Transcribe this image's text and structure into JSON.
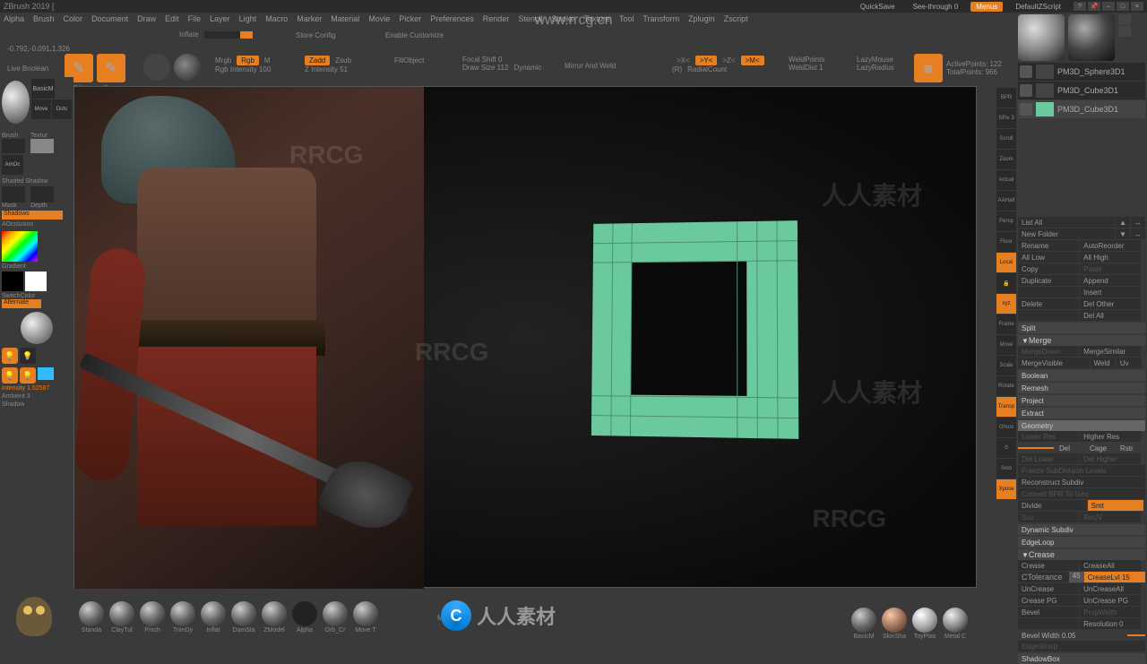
{
  "app": {
    "title": "ZBrush 2019 ["
  },
  "titlebar": {
    "quicksave": "QuickSave",
    "seethrough": "See-through  0",
    "menus": "Menus",
    "default": "DefaultZScript"
  },
  "menus": [
    "Alpha",
    "Brush",
    "Color",
    "Document",
    "Draw",
    "Edit",
    "File",
    "Layer",
    "Light",
    "Macro",
    "Marker",
    "Material",
    "Movie",
    "Picker",
    "Preferences",
    "Render",
    "Stencil",
    "Stroke",
    "Texture",
    "Tool",
    "Transform",
    "Zplugin",
    "Zscript"
  ],
  "coord": "-0.792,-0.091,1.326",
  "shelf": {
    "live_boolean": "Live Boolean",
    "edit": "Edit",
    "draw": "Draw",
    "inflate": "Inflate",
    "store_config": "Store Config",
    "enable_customize": "Enable Customize",
    "mrgb": "Mrgb",
    "rgb": "Rgb",
    "m": "M",
    "rgb_intensity": "Rgb Intensity 100",
    "zadd": "Zadd",
    "zsub": "Zsub",
    "z_intensity": "Z Intensity 51",
    "fillobject": "FillObject",
    "focal_shift": "Focal Shift 0",
    "draw_size": "Draw Size  112",
    "dynamic": "Dynamic",
    "mirror_weld": "Mirror And Weld",
    "x": ">X<",
    "y": ">Y<",
    "z": ">Z<",
    "m2": ">M<",
    "r": "(R)",
    "radialcount": "RadialCount",
    "weldpoints": "WeldPoints",
    "welddist": "WeldDist 1",
    "lazymouse": "LazyMouse",
    "lazyradius": "LazyRadius",
    "activepoints": "ActivePoints: 122",
    "totalpoints": "TotalPoints: 966"
  },
  "left": {
    "brush": "BasicM",
    "move": "Move",
    "dots": "Dots",
    "brush_l": "Brush",
    "texture": "Textur",
    "shaded": "Shaded",
    "shadow": "Shadow",
    "amoc": "AmOc",
    "mask": "Mask",
    "depth": "Depth",
    "shadows": "Shadows",
    "aocclusion": "AOcclusion",
    "gradient": "Gradient",
    "switchcolor": "SwitchColor",
    "alternate": "Alternate",
    "intensity": "Intensity 1.52587",
    "ambient": "Ambient 3",
    "shadow2": "Shadow"
  },
  "layers": [
    {
      "name": "PM3D_Sphere3D1"
    },
    {
      "name": "PM3D_Cube3D1"
    },
    {
      "name": "PM3D_Cube3D1"
    }
  ],
  "rpanel": {
    "listall": "List All",
    "newfolder": "New Folder",
    "rename": "Rename",
    "autoreorder": "AutoReorder",
    "alllow": "All Low",
    "allhigh": "All High",
    "copy": "Copy",
    "paste": "Paste",
    "duplicate": "Duplicate",
    "append": "Append",
    "insert": "Insert",
    "delete": "Delete",
    "delother": "Del Other",
    "delall": "Del All",
    "split": "Split",
    "merge": "Merge",
    "mergedown": "MergeDown",
    "mergesimilar": "MergeSimilar",
    "mergevisible": "MergeVisible",
    "weld": "Weld",
    "uv": "Uv",
    "boolean": "Boolean",
    "remesh": "Remesh",
    "project": "Project",
    "extract": "Extract",
    "geometry": "Geometry",
    "lowerres": "Lower Res",
    "higherres": "Higher Res",
    "del": "Del",
    "cage": "Cage",
    "rstr": "Rstr",
    "dellower": "Del Lower",
    "delhigher": "Del Higher",
    "freeze": "Freeze SubDivision Levels",
    "reconstruct": "Reconstruct Subdiv",
    "convert": "Convert BPR To Geo",
    "divide": "Divide",
    "smt": "Smt",
    "suv": "Suv",
    "reuv": "ReUV",
    "dynamic_subdiv": "Dynamic Subdiv",
    "edgeloop": "EdgeLoop",
    "crease": "Crease",
    "crease_btn": "Crease",
    "creaseall": "CreaseAll",
    "ctolerance": "CTolerance",
    "ctol_val": "45",
    "creaselvl": "CreaseLvl 15",
    "uncrease": "UnCrease",
    "uncreaseall": "UnCreaseAll",
    "creasepg": "Crease PG",
    "uncreasepg": "UnCrease PG",
    "bevel": "Bevel",
    "propwidth": "PropWidth",
    "resolution": "Resolution 0",
    "bevelwidth": "Bevel Width 0.05",
    "edgesharp": "EdgeSharp",
    "shadowbox": "ShadowBox"
  },
  "rtools": [
    "BPR",
    "SPix 3",
    "Scroll",
    "Zoom",
    "Actual",
    "AAHalf",
    "Persp",
    "Floor",
    "Local",
    "Frame",
    "Move",
    "Scale",
    "Rotate",
    "Transp",
    "Ghost",
    "Solo",
    "Xpose"
  ],
  "bottom": {
    "mirror": "Mirror",
    "brushes": [
      "Standa",
      "ClayTul",
      "Pinch",
      "TrimDy",
      "Inflat",
      "DamSta",
      "ZModel",
      "Alpha",
      "Orb_Cr",
      "Move T"
    ],
    "materials": [
      "BasicM",
      "SkinSha",
      "ToyPlas",
      "Metal C"
    ]
  },
  "watermark_url": "www.rrcg.cn",
  "watermark_text": "人人素材",
  "watermark_rrcg": "RRCG"
}
